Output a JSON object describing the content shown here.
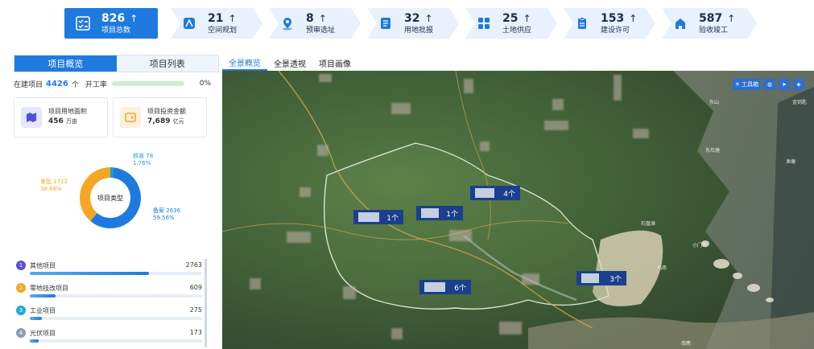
{
  "stats": [
    {
      "value": "826",
      "label": "项目总数",
      "icon": "checklist-icon"
    },
    {
      "value": "21",
      "label": "空间规划",
      "icon": "compass-icon"
    },
    {
      "value": "8",
      "label": "预审选址",
      "icon": "location-pin-icon"
    },
    {
      "value": "32",
      "label": "用地批报",
      "icon": "document-icon"
    },
    {
      "value": "25",
      "label": "土地供应",
      "icon": "grid-blocks-icon"
    },
    {
      "value": "153",
      "label": "建设许可",
      "icon": "clipboard-icon"
    },
    {
      "value": "587",
      "label": "验收竣工",
      "icon": "building-icon"
    }
  ],
  "up_arrow": "↑",
  "left_tabs": [
    "项目概览",
    "项目列表"
  ],
  "progress": {
    "label": "在建项目",
    "count": "4426",
    "unit": "个",
    "rate_label": "开工率",
    "rate": "0%"
  },
  "cards": [
    {
      "title": "项目用地面积",
      "value": "456",
      "unit": "万亩",
      "icon": "land-area-icon"
    },
    {
      "title": "项目投资金额",
      "value": "7,689",
      "unit": "亿元",
      "icon": "wallet-icon"
    }
  ],
  "donut": {
    "center": "项目类型",
    "slices": [
      {
        "name": "核准",
        "value": "78",
        "pct": "1.76%",
        "fraction": 0.0176,
        "color": "#1f9cd6"
      },
      {
        "name": "备案",
        "value": "2636",
        "pct": "59.56%",
        "fraction": 0.5956,
        "color": "#1f7ae0"
      },
      {
        "name": "审批",
        "value": "1712",
        "pct": "38.68%",
        "fraction": 0.3868,
        "color": "#f5a623"
      }
    ]
  },
  "categories": [
    {
      "rank": "1",
      "name": "其他项目",
      "value": "2763",
      "fraction": 0.69,
      "color": "#5a4fd1"
    },
    {
      "rank": "2",
      "name": "零地技改项目",
      "value": "609",
      "fraction": 0.15,
      "color": "#f5a623"
    },
    {
      "rank": "3",
      "name": "工业项目",
      "value": "275",
      "fraction": 0.07,
      "color": "#1fa8e0"
    },
    {
      "rank": "4",
      "name": "光伏项目",
      "value": "173",
      "fraction": 0.05,
      "color": "#8a9bb5"
    }
  ],
  "map_tabs": [
    "全景概览",
    "全景透视",
    "项目画像"
  ],
  "map_tools": [
    "工具箱"
  ],
  "markers": [
    {
      "count": "1个"
    },
    {
      "count": "1个"
    },
    {
      "count": "4个"
    },
    {
      "count": "6个"
    },
    {
      "count": "3个"
    }
  ],
  "places": [
    "东山",
    "金钥匙",
    "东坎塘",
    "渔塘",
    "石盘滩",
    "乌南",
    "小门岛",
    "南麂"
  ]
}
